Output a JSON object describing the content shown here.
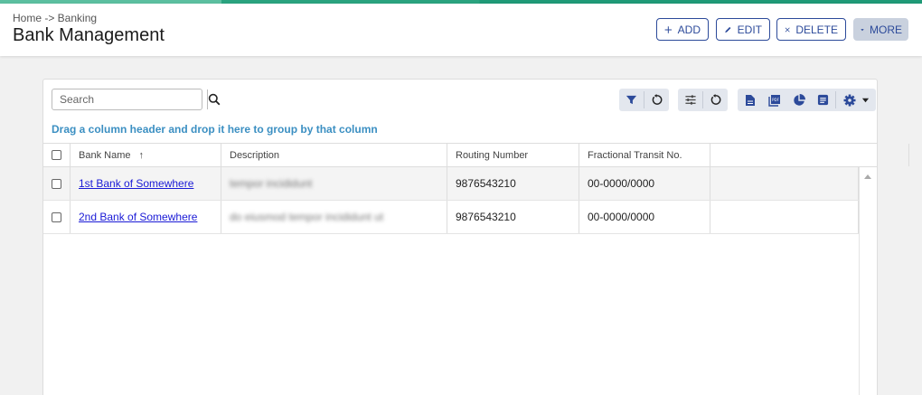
{
  "header": {
    "breadcrumb": "Home -> Banking",
    "title": "Bank Management",
    "buttons": {
      "add": "ADD",
      "edit": "EDIT",
      "delete": "DELETE",
      "more": "MORE"
    }
  },
  "toolbar": {
    "search_placeholder": "Search",
    "icons": [
      "filter-icon",
      "reset-icon",
      "sliders-icon",
      "reset-icon",
      "document-icon",
      "pdf-icon",
      "pie-chart-icon",
      "list-icon",
      "gear-icon"
    ]
  },
  "grid": {
    "group_hint": "Drag a column header and drop it here to group by that column",
    "columns": [
      "Bank Name",
      "Description",
      "Routing Number",
      "Fractional Transit No."
    ],
    "sort_indicator": "↑",
    "rows": [
      {
        "bank_name": "1st Bank of Somewhere",
        "description": "tempor incididunt",
        "routing": "9876543210",
        "fractional": "00-0000/0000"
      },
      {
        "bank_name": "2nd Bank of Somewhere",
        "description": "do eiusmod tempor incididunt ut",
        "routing": "9876543210",
        "fractional": "00-0000/0000"
      }
    ]
  },
  "colors": {
    "accent": "#2c4a9a",
    "hint": "#3b8fc2",
    "link": "#1a1ad6"
  }
}
